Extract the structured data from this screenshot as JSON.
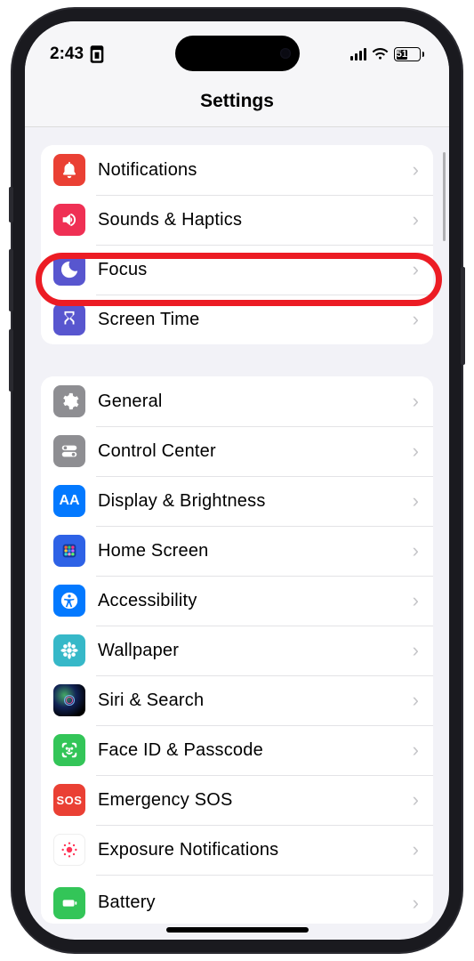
{
  "status": {
    "time": "2:43",
    "battery_percent": "51",
    "battery_fill_width": "51%"
  },
  "header": {
    "title": "Settings"
  },
  "groups": [
    {
      "items": [
        {
          "label": "Notifications",
          "icon": "bell-icon",
          "color": "ic-red"
        },
        {
          "label": "Sounds & Haptics",
          "icon": "speaker-icon",
          "color": "ic-pink"
        },
        {
          "label": "Focus",
          "icon": "moon-icon",
          "color": "ic-indigo"
        },
        {
          "label": "Screen Time",
          "icon": "hourglass-icon",
          "color": "ic-indigo"
        }
      ]
    },
    {
      "items": [
        {
          "label": "General",
          "icon": "gear-icon",
          "color": "ic-gray"
        },
        {
          "label": "Control Center",
          "icon": "switches-icon",
          "color": "ic-gray"
        },
        {
          "label": "Display & Brightness",
          "icon": "text-size-icon",
          "color": "ic-blue"
        },
        {
          "label": "Home Screen",
          "icon": "grid-icon",
          "color": "ic-homescreen"
        },
        {
          "label": "Accessibility",
          "icon": "accessibility-icon",
          "color": "ic-blue"
        },
        {
          "label": "Wallpaper",
          "icon": "flower-icon",
          "color": "ic-teal"
        },
        {
          "label": "Siri & Search",
          "icon": "siri-icon",
          "color": "ic-black"
        },
        {
          "label": "Face ID & Passcode",
          "icon": "faceid-icon",
          "color": "ic-green"
        },
        {
          "label": "Emergency SOS",
          "icon": "sos-icon",
          "color": "ic-sos"
        },
        {
          "label": "Exposure Notifications",
          "icon": "exposure-icon",
          "color": "ic-exposure"
        },
        {
          "label": "Battery",
          "icon": "battery-icon",
          "color": "ic-green"
        }
      ]
    }
  ]
}
